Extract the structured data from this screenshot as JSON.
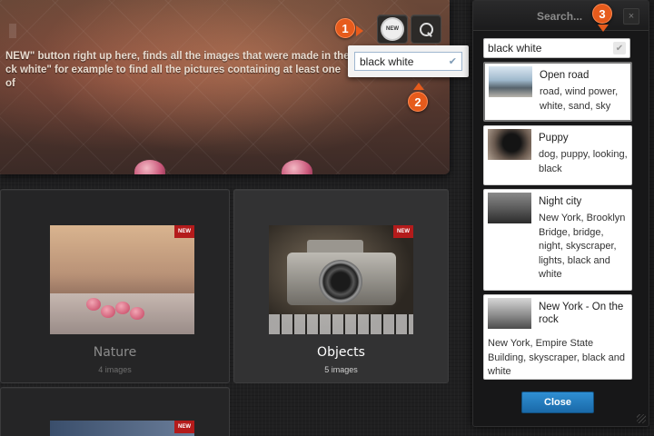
{
  "hero": {
    "text": "NEW\" button right up here, finds all the images that were made in the ck white\" for example to find all the pictures containing at least one of",
    "new_badge_label": "NEW",
    "search_value": "black white"
  },
  "markers": [
    "1",
    "2",
    "3"
  ],
  "gallery": {
    "cards": [
      {
        "title": "Nature",
        "count": "4 images",
        "new_tag": "NEW"
      },
      {
        "title": "Objects",
        "count": "5 images",
        "new_tag": "NEW"
      }
    ],
    "partial_new_tag": "NEW"
  },
  "search_panel": {
    "title": "Search...",
    "close_glyph": "×",
    "query": "black white",
    "results": [
      {
        "title": "Open road",
        "tags": "road, wind power, white, sand, sky"
      },
      {
        "title": "Puppy",
        "tags": "dog, puppy, looking, black"
      },
      {
        "title": "Night city",
        "tags": "New York, Brooklyn Bridge, bridge, night, skyscraper, lights, black and white"
      },
      {
        "title": "New York - On the rock",
        "tags": "New York, Empire State Building, skyscraper, black and white"
      }
    ],
    "close_button": "Close"
  },
  "colors": {
    "marker": "#e65b1c",
    "close_button": "#1f78bd",
    "new_tag": "#b41b1b"
  }
}
